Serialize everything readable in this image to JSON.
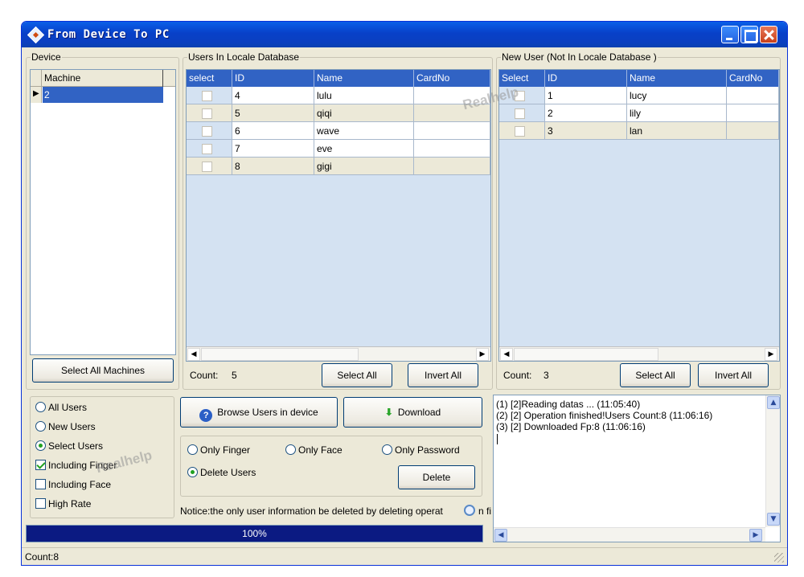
{
  "window": {
    "title": "From Device To PC"
  },
  "device": {
    "legend": "Device",
    "column": "Machine",
    "rows": [
      "2"
    ],
    "select_all_label": "Select All Machines"
  },
  "local_users": {
    "legend": "Users In Locale Database",
    "columns": [
      "select",
      "ID",
      "Name",
      "CardNo"
    ],
    "rows": [
      {
        "id": "4",
        "name": "lulu",
        "card": ""
      },
      {
        "id": "5",
        "name": "qiqi",
        "card": ""
      },
      {
        "id": "6",
        "name": "wave",
        "card": ""
      },
      {
        "id": "7",
        "name": "eve",
        "card": ""
      },
      {
        "id": "8",
        "name": "gigi",
        "card": ""
      }
    ],
    "count_label": "Count:",
    "count_value": "5",
    "select_all_label": "Select All",
    "invert_all_label": "Invert All"
  },
  "new_users": {
    "legend": "New User (Not In Locale Database )",
    "columns": [
      "Select",
      "ID",
      "Name",
      "CardNo"
    ],
    "rows": [
      {
        "id": "1",
        "name": "lucy",
        "card": ""
      },
      {
        "id": "2",
        "name": "lily",
        "card": ""
      },
      {
        "id": "3",
        "name": "lan",
        "card": ""
      }
    ],
    "count_label": "Count:",
    "count_value": "3",
    "select_all_label": "Select All",
    "invert_all_label": "Invert All"
  },
  "filters": {
    "all_users": "All Users",
    "new_users": "New Users",
    "select_users": "Select Users",
    "selected": "Select Users",
    "including_finger": "Including Finger",
    "including_finger_checked": true,
    "including_face": "Including Face",
    "including_face_checked": false,
    "high_rate": "High Rate",
    "high_rate_checked": false
  },
  "actions": {
    "browse_label": "Browse Users in device",
    "download_label": "Download",
    "only_finger": "Only Finger",
    "only_face": "Only Face",
    "only_password": "Only Password",
    "delete_users": "Delete Users",
    "delete_label": "Delete",
    "notice": "Notice:the only user information  be deleted by deleting operat",
    "notice_tail": "n fi"
  },
  "progress": {
    "value_percent": 100,
    "label": "100%"
  },
  "log": {
    "lines": [
      "(1) [2]Reading datas ... (11:05:40)",
      "(2) [2] Operation finished!Users Count:8 (11:06:16)",
      "(3) [2] Downloaded Fp:8 (11:06:16)"
    ]
  },
  "status": {
    "text": "Count:8"
  },
  "watermarks": [
    "Realhelp",
    "Realhelp"
  ],
  "colors": {
    "titlebar": "#0a4fd8",
    "grid_header": "#3163c4",
    "grid_body": "#d4e2f2",
    "progress": "#0b1a82",
    "selected_row": "#3163c4"
  }
}
